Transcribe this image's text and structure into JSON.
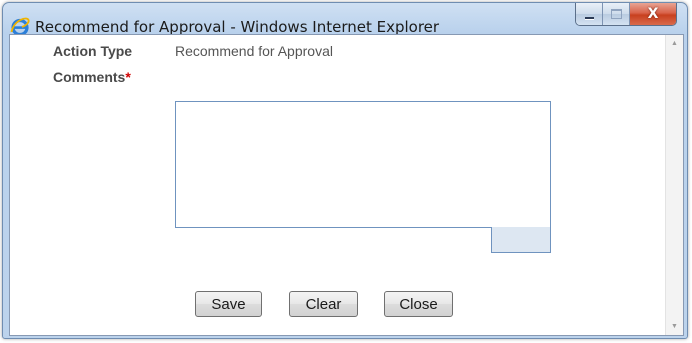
{
  "window": {
    "title": "Recommend for Approval - Windows Internet Explorer",
    "close_glyph": "X"
  },
  "form": {
    "action_type_label": "Action Type",
    "action_type_value": "Recommend for Approval",
    "comments_label": "Comments",
    "required_marker": "*",
    "comments_value": ""
  },
  "buttons": {
    "save": "Save",
    "clear": "Clear",
    "close": "Close"
  },
  "icons": {
    "app": "internet-explorer-icon",
    "minimize": "minimize-icon",
    "maximize": "maximize-icon",
    "close": "close-icon",
    "scroll_up": "scroll-up-arrow-icon",
    "scroll_down": "scroll-down-arrow-icon"
  },
  "colors": {
    "titlebar": "#bcd3ec",
    "close_button": "#c8401f",
    "required": "#d00000",
    "field_border": "#6f93bf"
  }
}
